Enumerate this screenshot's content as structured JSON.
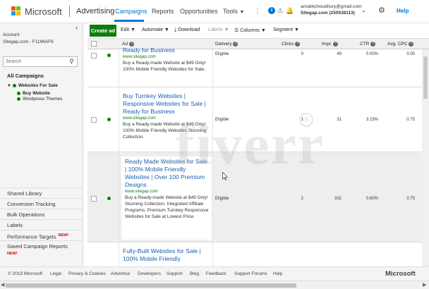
{
  "header": {
    "brand": "Microsoft",
    "product": "Advertising",
    "nav": [
      "Campaigns",
      "Reports",
      "Opportunities",
      "Tools"
    ],
    "account_email": "arnabkchoudhury@gmail.com",
    "account_name": "Sitegap.com (250538113)",
    "help": "Help",
    "more": "⋮"
  },
  "sidebar": {
    "account_label": "Account",
    "account_value": "Sitegap.com - F1196AF6",
    "search_placeholder": "Search",
    "all_campaigns": "All Campaigns",
    "campaign": "Websites For Sale",
    "ad_groups": [
      "Buy Website",
      "Wordpress Themes"
    ],
    "links": [
      "Shared Library",
      "Conversion Tracking",
      "Bulk Operations",
      "Labels",
      "Performance Targets",
      "Saved Campaign Reports"
    ],
    "new_badge": "NEW!"
  },
  "toolbar": {
    "create": "Create ad",
    "edit": "Edit",
    "automate": "Automate",
    "download": "Download",
    "labels": "Labels",
    "columns": "Columns",
    "segment": "Segment"
  },
  "table": {
    "headers": [
      "Ad",
      "Delivery",
      "Clicks",
      "Impr.",
      "CTR",
      "Avg. CPC"
    ],
    "rows": [
      {
        "title": "Ready for Business",
        "url": "www.sitegap.com",
        "desc": "Buy a Ready-made Website at $49 Only! 100% Mobile Friendly Websites for Sale.",
        "delivery": "Eligible",
        "clicks": "0",
        "impr": "49",
        "ctr": "0.00%",
        "cpc": "0.00"
      },
      {
        "title": "Buy Turnkey Websites | Responsive Websites for Sale | Ready for Business",
        "url": "www.sitegap.com",
        "desc": "Buy a Ready-made Website at $49 Only! 100% Mobile Friendly Websites Stunning Collection.",
        "delivery": "Eligible",
        "clicks": "1",
        "impr": "31",
        "ctr": "3.23%",
        "cpc": "0.75"
      },
      {
        "title": "Ready Made Websites for Sale | 100% Mobile Friendly Websites | Over 100 Premium Designs",
        "url": "www.sitegap.com",
        "desc": "Buy a Ready-made Website at $49 Only! Stunning Collection. Integrated Affiliate Programs. Premium Turnkey Responsive Websites for Sale at Lowest Price.",
        "delivery": "Eligible",
        "clicks": "2",
        "impr": "332",
        "ctr": "0.60%",
        "cpc": "0.75"
      },
      {
        "title": "Fully-Built Websites for Sale | 100% Mobile Friendly",
        "url": "",
        "desc": "",
        "delivery": "",
        "clicks": "",
        "impr": "",
        "ctr": "",
        "cpc": ""
      }
    ]
  },
  "footer": {
    "links": [
      "© 2019 Microsoft",
      "Legal",
      "Privacy & Cookies",
      "Advertise",
      "Developers",
      "Support",
      "Blog",
      "Feedback",
      "Support Forums",
      "Help"
    ],
    "brand": "Microsoft"
  },
  "watermark": "fiverr",
  "colors": {
    "accent": "#0078d4",
    "green": "#107c10",
    "link": "#1a5fb4"
  }
}
